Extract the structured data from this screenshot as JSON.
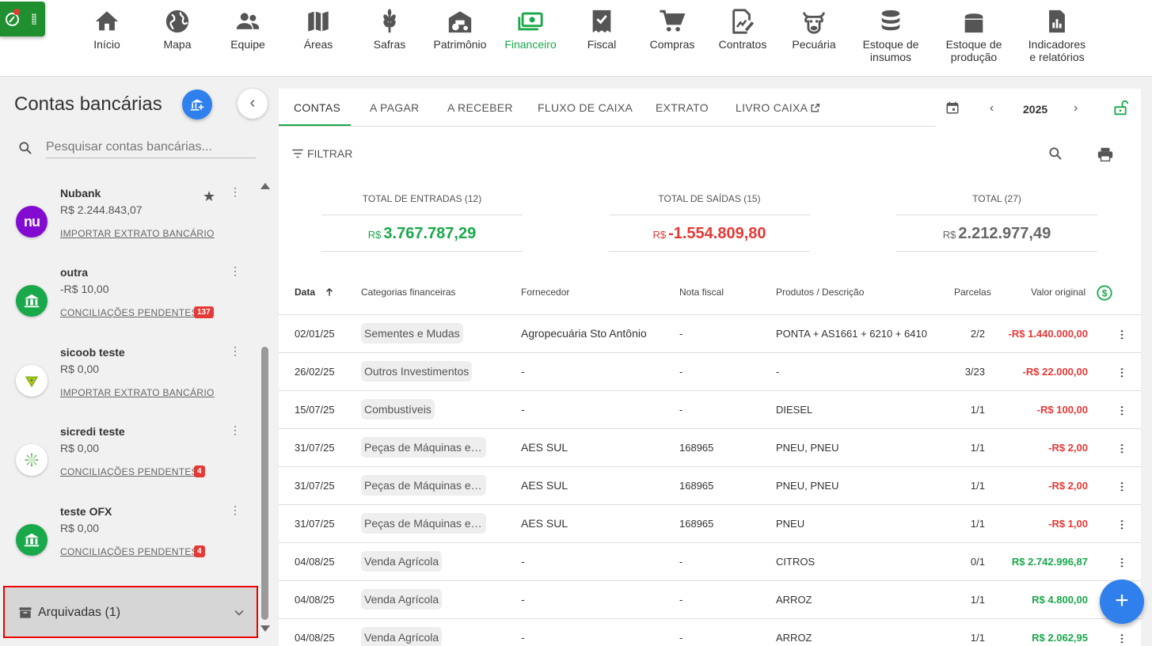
{
  "nav": {
    "items": [
      {
        "label": "Início",
        "icon": "home-icon"
      },
      {
        "label": "Mapa",
        "icon": "globe-icon"
      },
      {
        "label": "Equipe",
        "icon": "people-icon"
      },
      {
        "label": "Áreas",
        "icon": "map-icon"
      },
      {
        "label": "Safras",
        "icon": "wheat-icon"
      },
      {
        "label": "Patrimônio",
        "icon": "tractor-barn-icon"
      },
      {
        "label": "Financeiro",
        "icon": "cash-icon"
      },
      {
        "label": "Fiscal",
        "icon": "receipt-icon"
      },
      {
        "label": "Compras",
        "icon": "cart-icon"
      },
      {
        "label": "Contratos",
        "icon": "contract-icon"
      },
      {
        "label": "Pecuária",
        "icon": "cow-icon"
      },
      {
        "label": "Estoque de insumos",
        "label1": "Estoque de",
        "label2": "insumos",
        "icon": "database-icon"
      },
      {
        "label": "Estoque de produção",
        "label1": "Estoque de",
        "label2": "produção",
        "icon": "silo-icon"
      },
      {
        "label": "Indicadores e relatórios",
        "label1": "Indicadores",
        "label2": "e relatórios",
        "icon": "report-icon"
      }
    ],
    "active": "Financeiro",
    "accent": "#19a84a"
  },
  "left": {
    "title": "Contas bancárias",
    "search_placeholder": "Pesquisar contas bancárias...",
    "accounts": [
      {
        "name": "Nubank",
        "balance": "R$ 2.244.843,07",
        "link": "IMPORTAR EXTRATO BANCÁRIO",
        "badge": "",
        "starred": true,
        "logo": "nubank-logo"
      },
      {
        "name": "outra",
        "balance": "-R$ 10,00",
        "link": "CONCILIAÇÕES PENDENTES",
        "badge": "137",
        "logo": "bank-icon"
      },
      {
        "name": "sicoob teste",
        "balance": "R$ 0,00",
        "link": "IMPORTAR EXTRATO BANCÁRIO",
        "badge": "",
        "logo": "sicoob-logo"
      },
      {
        "name": "sicredi teste",
        "balance": "R$ 0,00",
        "link": "CONCILIAÇÕES PENDENTES",
        "badge": "4",
        "logo": "sicredi-logo"
      },
      {
        "name": "teste OFX",
        "balance": "R$ 0,00",
        "link": "CONCILIAÇÕES PENDENTES",
        "badge": "4",
        "logo": "bank-icon"
      }
    ],
    "archived_label": "Arquivadas (1)"
  },
  "tabs": [
    "CONTAS",
    "A PAGAR",
    "A RECEBER",
    "FLUXO DE CAIXA",
    "EXTRATO",
    "LIVRO CAIXA"
  ],
  "year": "2025",
  "filter_label": "FILTRAR",
  "totals": [
    {
      "title": "TOTAL DE ENTRADAS (12)",
      "currency": "R$",
      "value": "3.767.787,29",
      "color": "#19a84a"
    },
    {
      "title": "TOTAL DE SAÍDAS (15)",
      "currency": "R$",
      "value": "-1.554.809,80",
      "color": "#e53935"
    },
    {
      "title": "TOTAL (27)",
      "currency": "R$",
      "value": "2.212.977,49",
      "color": "#666666"
    }
  ],
  "table": {
    "headers": [
      "Data",
      "Categorias financeiras",
      "Fornecedor",
      "Nota fiscal",
      "Produtos / Descrição",
      "Parcelas",
      "Valor original"
    ],
    "rows": [
      {
        "data": "02/01/25",
        "cat": "Sementes e Mudas",
        "forn": "Agropecuária Sto Antônio",
        "nf": "-",
        "prod": "PONTA + AS1661 + 6210 + 6410",
        "parc": "2/2",
        "valor": "-R$ 1.440.000,00",
        "sign": "neg"
      },
      {
        "data": "26/02/25",
        "cat": "Outros Investimentos",
        "forn": "-",
        "nf": "-",
        "prod": "-",
        "parc": "3/23",
        "valor": "-R$ 22.000,00",
        "sign": "neg"
      },
      {
        "data": "15/07/25",
        "cat": "Combustíveis",
        "forn": "-",
        "nf": "-",
        "prod": "DIESEL",
        "parc": "1/1",
        "valor": "-R$ 100,00",
        "sign": "neg"
      },
      {
        "data": "31/07/25",
        "cat": "Peças de Máquinas e Implementos",
        "forn": "AES SUL",
        "nf": "168965",
        "prod": "PNEU, PNEU",
        "parc": "1/1",
        "valor": "-R$ 2,00",
        "sign": "neg"
      },
      {
        "data": "31/07/25",
        "cat": "Peças de Máquinas e Implementos",
        "forn": "AES SUL",
        "nf": "168965",
        "prod": "PNEU, PNEU",
        "parc": "1/1",
        "valor": "-R$ 2,00",
        "sign": "neg"
      },
      {
        "data": "31/07/25",
        "cat": "Peças de Máquinas e Implementos",
        "forn": "AES SUL",
        "nf": "168965",
        "prod": "PNEU",
        "parc": "1/1",
        "valor": "-R$ 1,00",
        "sign": "neg"
      },
      {
        "data": "04/08/25",
        "cat": "Venda Agrícola",
        "forn": "-",
        "nf": "-",
        "prod": "CITROS",
        "parc": "0/1",
        "valor": "R$ 2.742.996,87",
        "sign": "pos"
      },
      {
        "data": "04/08/25",
        "cat": "Venda Agrícola",
        "forn": "-",
        "nf": "-",
        "prod": "ARROZ",
        "parc": "1/1",
        "valor": "R$ 4.800,00",
        "sign": "pos"
      },
      {
        "data": "04/08/25",
        "cat": "Venda Agrícola",
        "forn": "-",
        "nf": "-",
        "prod": "ARROZ",
        "parc": "1/1",
        "valor": "R$ 2.062,95",
        "sign": "pos"
      }
    ]
  }
}
